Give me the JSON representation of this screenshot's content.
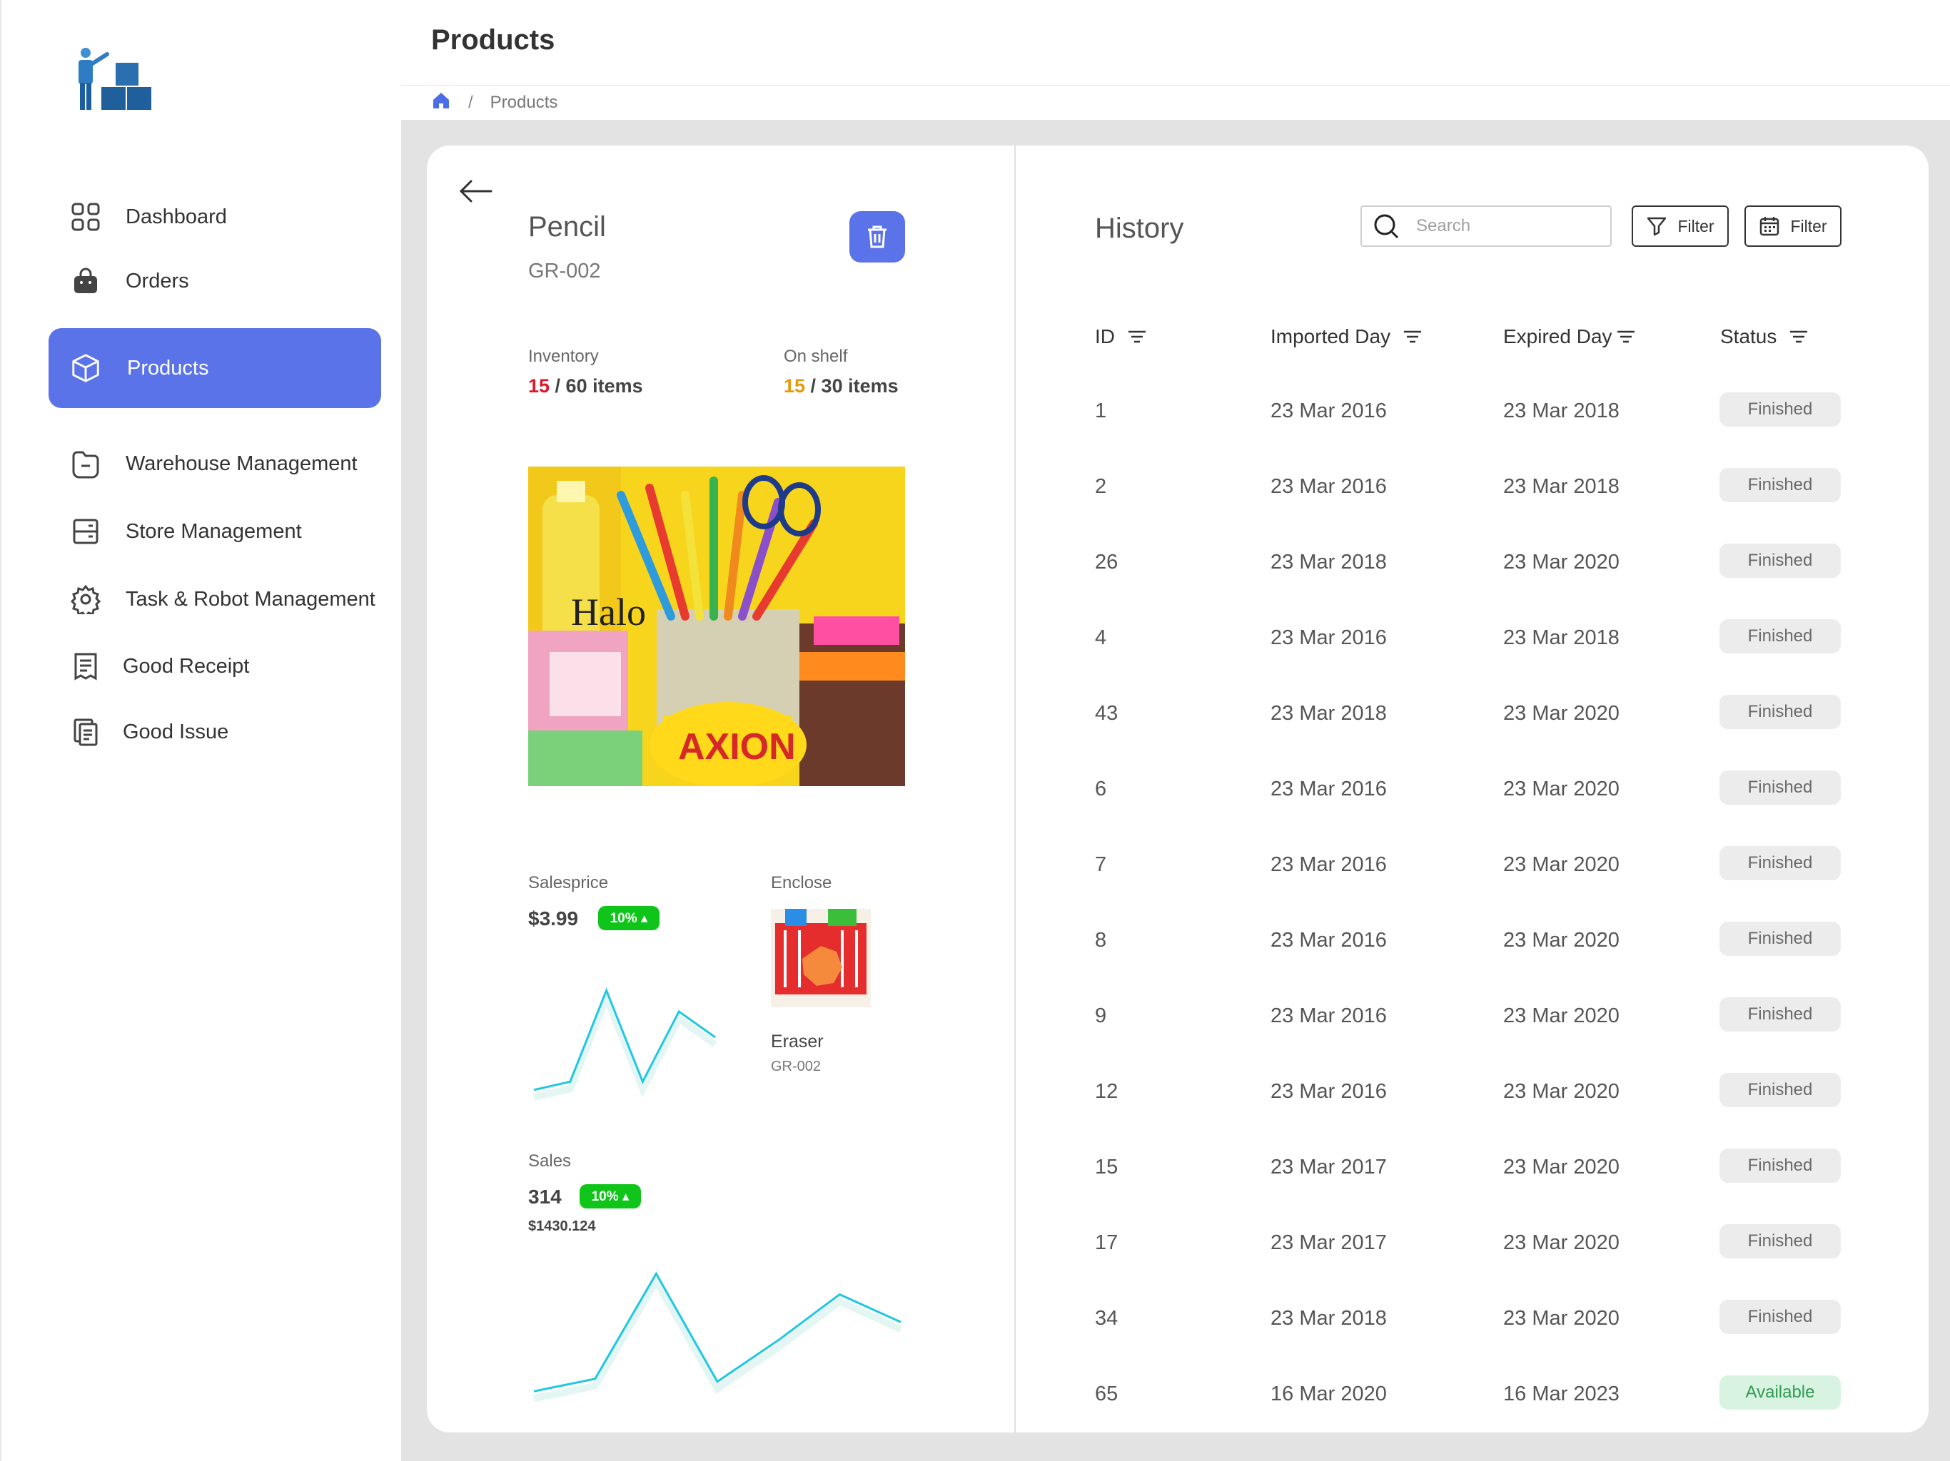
{
  "header": {
    "title": "Products"
  },
  "breadcrumb": {
    "current": "Products",
    "separator": "/"
  },
  "sidebar": {
    "items": [
      {
        "label": "Dashboard",
        "icon": "grid-icon"
      },
      {
        "label": "Orders",
        "icon": "bag-icon"
      },
      {
        "label": "Products",
        "icon": "box-icon",
        "active": true
      },
      {
        "label": "Warehouse Management",
        "icon": "folder-icon"
      },
      {
        "label": "Store Management",
        "icon": "storage-icon"
      },
      {
        "label": "Task & Robot Management",
        "icon": "gear-icon"
      },
      {
        "label": "Good Receipt",
        "icon": "receipt-icon"
      },
      {
        "label": "Good Issue",
        "icon": "documents-icon"
      }
    ]
  },
  "product": {
    "name": "Pencil",
    "code": "GR-002",
    "inventory": {
      "label": "Inventory",
      "current": "15",
      "rest": " / 60 items"
    },
    "on_shelf": {
      "label": "On shelf",
      "current": "15",
      "rest": " / 30 items"
    },
    "salesprice": {
      "label": "Salesprice",
      "value": "$3.99",
      "badge": "10% ▴",
      "trend": [
        0.05,
        0.12,
        0.9,
        0.12,
        0.72,
        0.5
      ]
    },
    "enclose": {
      "label": "Enclose",
      "item_name": "Eraser",
      "item_code": "GR-002"
    },
    "sales": {
      "label": "Sales",
      "value": "314",
      "badge": "10% ▴",
      "amount": "$1430.124",
      "trend": [
        0.05,
        0.14,
        0.9,
        0.12,
        0.42,
        0.75,
        0.55
      ]
    }
  },
  "history": {
    "title": "History",
    "search_placeholder": "Search",
    "filter1_label": "Filter",
    "filter2_label": "Filter",
    "columns": [
      "ID",
      "Imported Day",
      "Expired Day",
      "Status"
    ],
    "rows": [
      {
        "id": "1",
        "imported": "23 Mar 2016",
        "expired": "23 Mar 2018",
        "status": "Finished"
      },
      {
        "id": "2",
        "imported": "23 Mar 2016",
        "expired": "23 Mar 2018",
        "status": "Finished"
      },
      {
        "id": "26",
        "imported": "23 Mar 2018",
        "expired": "23 Mar 2020",
        "status": "Finished"
      },
      {
        "id": "4",
        "imported": "23 Mar 2016",
        "expired": "23 Mar 2018",
        "status": "Finished"
      },
      {
        "id": "43",
        "imported": "23 Mar 2018",
        "expired": "23 Mar 2020",
        "status": "Finished"
      },
      {
        "id": "6",
        "imported": "23 Mar 2016",
        "expired": "23 Mar 2020",
        "status": "Finished"
      },
      {
        "id": "7",
        "imported": "23 Mar 2016",
        "expired": "23 Mar 2020",
        "status": "Finished"
      },
      {
        "id": "8",
        "imported": "23 Mar 2016",
        "expired": "23 Mar 2020",
        "status": "Finished"
      },
      {
        "id": "9",
        "imported": "23 Mar 2016",
        "expired": "23 Mar 2020",
        "status": "Finished"
      },
      {
        "id": "12",
        "imported": "23 Mar 2016",
        "expired": "23 Mar 2020",
        "status": "Finished"
      },
      {
        "id": "15",
        "imported": "23 Mar 2017",
        "expired": "23 Mar 2020",
        "status": "Finished"
      },
      {
        "id": "17",
        "imported": "23 Mar 2017",
        "expired": "23 Mar 2020",
        "status": "Finished"
      },
      {
        "id": "34",
        "imported": "23 Mar 2018",
        "expired": "23 Mar 2020",
        "status": "Finished"
      },
      {
        "id": "65",
        "imported": "16 Mar 2020",
        "expired": "16 Mar 2023",
        "status": "Available"
      }
    ]
  },
  "colors": {
    "accent": "#5b73e8",
    "danger": "#e0162b",
    "warning": "#e59b0d",
    "success": "#10c51a",
    "chart_line": "#1ec8e0"
  }
}
